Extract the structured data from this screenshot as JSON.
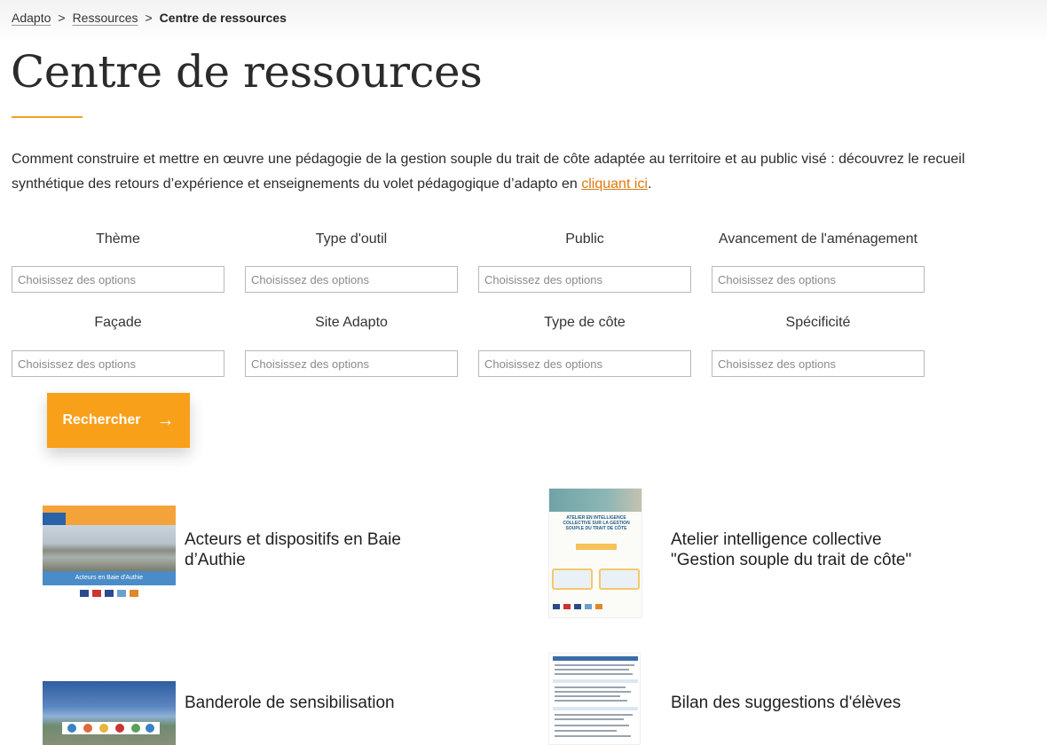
{
  "breadcrumb": {
    "items": [
      "Adapto",
      "Ressources"
    ],
    "separator": ">",
    "current": "Centre de ressources"
  },
  "page": {
    "title": "Centre de ressources",
    "intro_text": "Comment construire et mettre en œuvre une pédagogie de la gestion souple du trait de côte adaptée au territoire et au public visé : découvrez le recueil synthétique des retours d’expérience et enseignements du volet pédagogique d’adapto en ",
    "intro_link": "cliquant ici",
    "intro_end": "."
  },
  "filters": [
    {
      "label": "Thème",
      "placeholder": "Choisissez des options"
    },
    {
      "label": "Type d'outil",
      "placeholder": "Choisissez des options"
    },
    {
      "label": "Public",
      "placeholder": "Choisissez des options"
    },
    {
      "label": "Avancement de l'aménagement",
      "placeholder": "Choisissez des options"
    },
    {
      "label": "Façade",
      "placeholder": "Choisissez des options"
    },
    {
      "label": "Site Adapto",
      "placeholder": "Choisissez des options"
    },
    {
      "label": "Type de côte",
      "placeholder": "Choisissez des options"
    },
    {
      "label": "Spécificité",
      "placeholder": "Choisissez des options"
    }
  ],
  "search_button": {
    "label": "Rechercher",
    "icon": "arrow-right-icon"
  },
  "resources": [
    {
      "title": "Acteurs et dispositifs en Baie d’Authie",
      "thumb_caption": "Acteurs en Baie d'Authie",
      "thumb_logo": "adapto"
    },
    {
      "title": "Atelier intelligence collective \"Gestion souple du trait de côte\"",
      "thumb_caption": "ATELIER EN INTELLIGENCE COLLECTIVE SUR LA GESTION SOUPLE DU TRAIT DE CÔTE",
      "thumb_subtitle": "RAPPORT DE SYNTHÈSE"
    },
    {
      "title": "Banderole de sensibilisation"
    },
    {
      "title": "Bilan des suggestions d'élèves"
    }
  ],
  "colors": {
    "accent": "#f9a01b",
    "link": "#e07a10",
    "text": "#2b2b2b"
  }
}
